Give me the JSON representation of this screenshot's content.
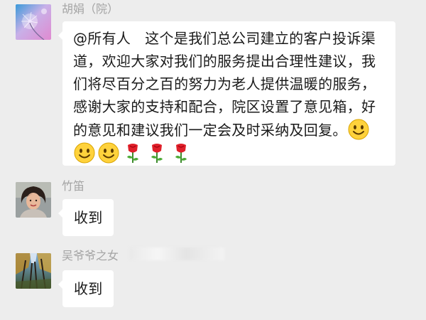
{
  "messages": [
    {
      "sender": "胡娟（院）",
      "avatar_icon": "dandelion-photo-avatar",
      "text": "@所有人   这个是我们总公司建立的客户投诉渠道，欢迎大家对我们的服务提出合理性建议，我们将尽百分之百的努力为老人提供温暖的服务，感谢大家的支持和配合，院区设置了意见箱，好的意见和建议我们一定会及时采纳及回复。",
      "trailing_emoji": [
        "smile-emoji",
        "smile-emoji",
        "smile-emoji",
        "rose-emoji",
        "rose-emoji",
        "rose-emoji"
      ]
    },
    {
      "sender": "竹笛",
      "avatar_icon": "woman-portrait-avatar",
      "text": "收到"
    },
    {
      "sender": "吴爷爷之女",
      "sender_redacted": true,
      "avatar_icon": "forest-photo-avatar",
      "text": "收到"
    }
  ],
  "colors": {
    "background": "#ededed",
    "bubble": "#ffffff",
    "sender_name": "#a4a4a4",
    "text": "#1a1a1a"
  }
}
